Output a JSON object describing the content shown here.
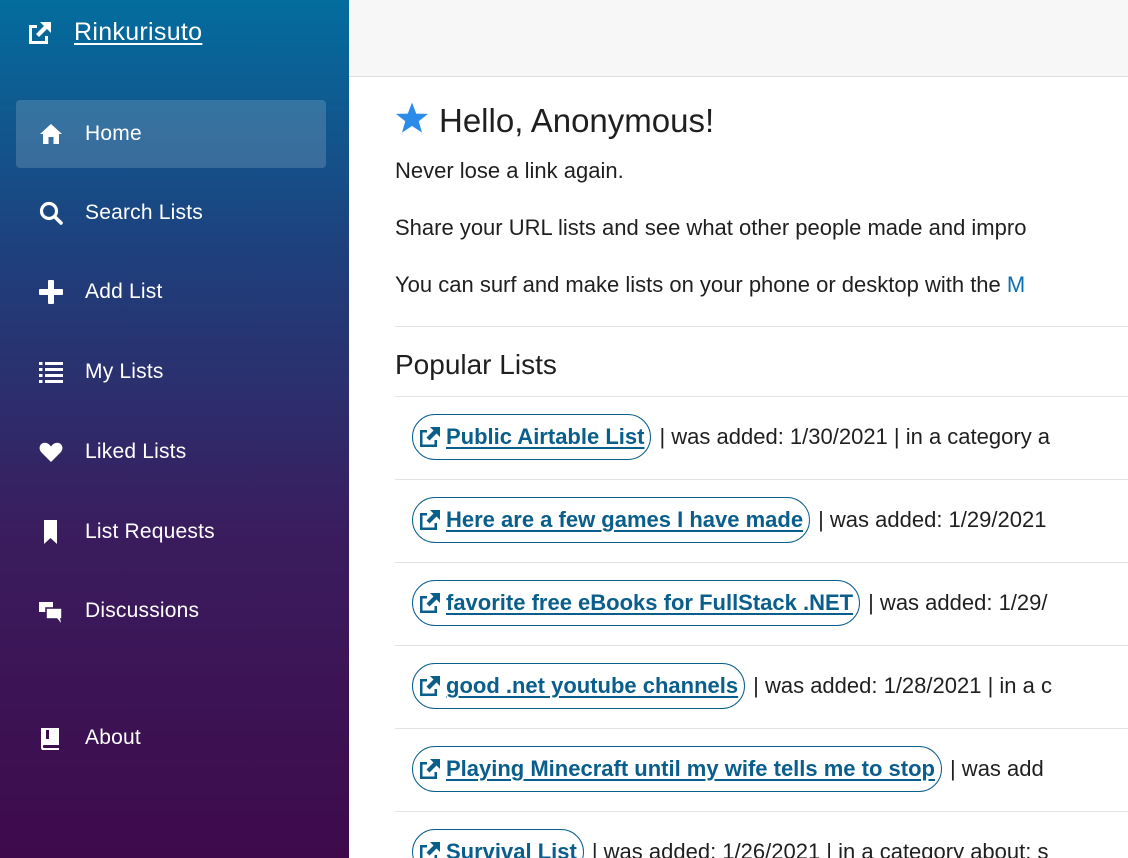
{
  "brand": {
    "name": "Rinkurisuto",
    "icon": "external-link-icon"
  },
  "nav": [
    {
      "label": "Home",
      "icon": "home-icon",
      "active": true
    },
    {
      "label": "Search Lists",
      "icon": "search-icon"
    },
    {
      "label": "Add List",
      "icon": "plus-icon"
    },
    {
      "label": "My Lists",
      "icon": "list-icon"
    },
    {
      "label": "Liked Lists",
      "icon": "heart-icon"
    },
    {
      "label": "List Requests",
      "icon": "bookmark-icon"
    },
    {
      "label": "Discussions",
      "icon": "chat-icon"
    },
    {
      "label": "About",
      "icon": "book-icon"
    }
  ],
  "main": {
    "greeting": "Hello, Anonymous!",
    "tagline": "Never lose a link again.",
    "share_text": "Share your URL lists and see what other people made and impro",
    "surf_text": "You can surf and make lists on your phone or desktop with the ",
    "surf_link_fragment": "M",
    "popular_title": "Popular Lists",
    "lists": [
      {
        "title": " Public Airtable List",
        "meta": "| was added: 1/30/2021 | in a category a"
      },
      {
        "title": " Here are a few games I have made",
        "meta": "| was added: 1/29/2021"
      },
      {
        "title": " favorite free eBooks for FullStack .NET",
        "meta": "| was added: 1/29/"
      },
      {
        "title": " good .net youtube channels",
        "meta": "| was added: 1/28/2021 | in a c"
      },
      {
        "title": " Playing Minecraft until my wife tells me to stop",
        "meta": "| was add"
      },
      {
        "title": " Survival List",
        "meta": "| was added: 1/26/2021 | in a category about: s"
      }
    ]
  },
  "colors": {
    "sidebar_top": "#036d9e",
    "sidebar_bottom": "#3e0a4c",
    "link": "#0a5e8c",
    "star": "#2a8ce8"
  }
}
